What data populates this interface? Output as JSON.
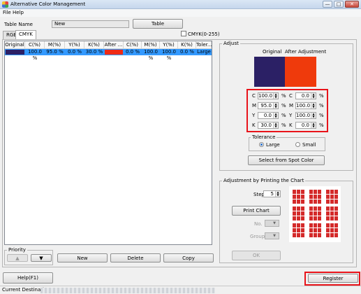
{
  "window": {
    "title": "Alternative Color Management",
    "min": "—",
    "max": "□",
    "close": "✕"
  },
  "menu": {
    "file": "File",
    "help": "Help"
  },
  "table_name": {
    "label": "Table Name",
    "value": "New",
    "button": "Table"
  },
  "tabs": [
    {
      "label": "RGB"
    },
    {
      "label": "CMYK"
    }
  ],
  "cmyk_option": {
    "label": "CMYK(0-255)",
    "checked": false
  },
  "table": {
    "headers": [
      "Original",
      "C(%)",
      "M(%)",
      "Y(%)",
      "K(%)",
      "After ...",
      "C(%)",
      "M(%)",
      "Y(%)",
      "K(%)",
      "Toler..."
    ],
    "rows": [
      {
        "orig_color": "#2b2065",
        "c": "100.0 %",
        "m": "95.0 %",
        "y": "0.0 %",
        "k": "30.0 %",
        "after_color": "#ef2b15",
        "c2": "0.0 %",
        "m2": "100.0 %",
        "y2": "100.0 %",
        "k2": "0.0 %",
        "tol": "Large"
      }
    ]
  },
  "priority": {
    "label": "Priority",
    "up": "▲",
    "down": "▼"
  },
  "actions": {
    "new": "New",
    "delete": "Delete",
    "copy": "Copy"
  },
  "adjust": {
    "title": "Adjust",
    "original_label": "Original",
    "after_label": "After Adjustment",
    "original_color": "#2b2065",
    "after_color": "#ef3a0c",
    "orig_values": [
      {
        "ch": "C",
        "v": "100.0"
      },
      {
        "ch": "M",
        "v": "95.0"
      },
      {
        "ch": "Y",
        "v": "0.0"
      },
      {
        "ch": "K",
        "v": "30.0"
      }
    ],
    "after_values": [
      {
        "ch": "C",
        "v": "0.0"
      },
      {
        "ch": "M",
        "v": "100.0"
      },
      {
        "ch": "Y",
        "v": "100.0"
      },
      {
        "ch": "K",
        "v": "0.0"
      }
    ],
    "pct": "%",
    "tolerance": {
      "title": "Tolerance",
      "large": "Large",
      "small": "Small",
      "selected": "Large"
    },
    "spot_button": "Select from Spot Color"
  },
  "print_adjust": {
    "title": "Adjustment by Printing the Chart",
    "step_label": "Step",
    "step_value": "5",
    "print_button": "Print Chart",
    "no_label": "No.",
    "group_label": "Group",
    "ok_button": "OK"
  },
  "footer": {
    "help": "Help(F1)",
    "register": "Register",
    "status": "Current Destination"
  },
  "colors": {
    "highlight": "#e8131a",
    "selection": "#3399ff",
    "chart_cell": "#d42a2a"
  }
}
